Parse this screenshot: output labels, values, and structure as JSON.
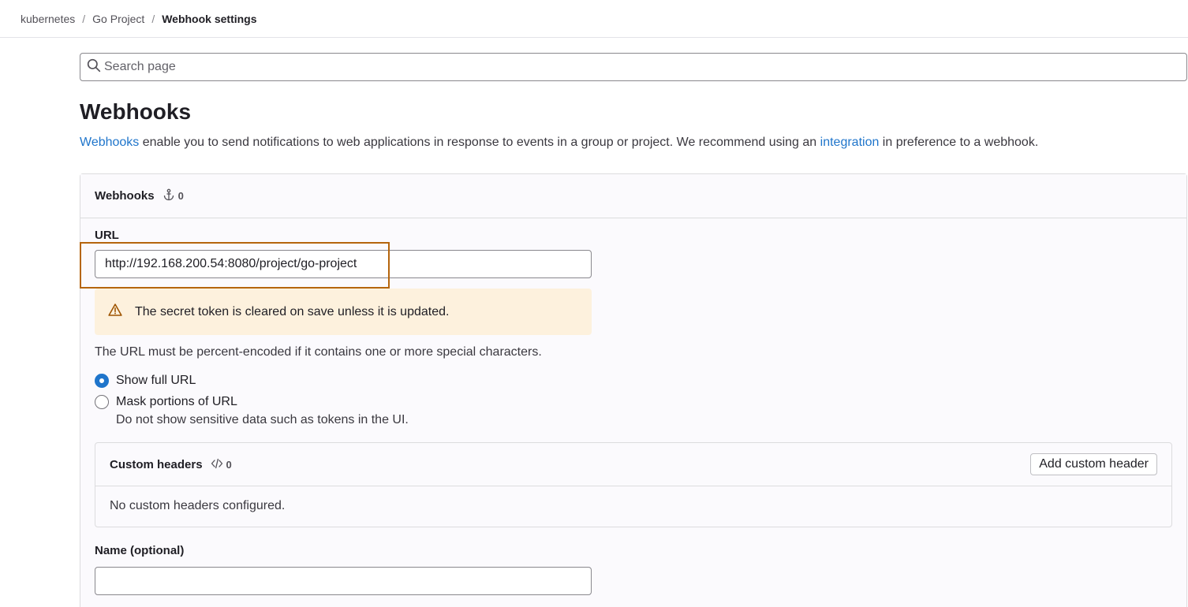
{
  "breadcrumb": {
    "items": [
      "kubernetes",
      "Go Project"
    ],
    "separator": "/",
    "current": "Webhook settings"
  },
  "search": {
    "placeholder": "Search page"
  },
  "page": {
    "title": "Webhooks",
    "description": {
      "link1": "Webhooks",
      "middle": " enable you to send notifications to web applications in response to events in a group or project. We recommend using an ",
      "link2": "integration",
      "end": " in preference to a webhook."
    }
  },
  "webhooks_card": {
    "title": "Webhooks",
    "count": "0",
    "url_label": "URL",
    "url_value": "http://192.168.200.54:8080/project/go-project",
    "alert_text": "The secret token is cleared on save unless it is updated.",
    "url_help": "The URL must be percent-encoded if it contains one or more special characters.",
    "radio_show_full": "Show full URL",
    "radio_mask": "Mask portions of URL",
    "radio_mask_help": "Do not show sensitive data such as tokens in the UI.",
    "name_label": "Name (optional)",
    "name_value": ""
  },
  "custom_headers": {
    "title": "Custom headers",
    "count": "0",
    "add_button": "Add custom header",
    "empty_text": "No custom headers configured."
  },
  "colors": {
    "link": "#1f75cb",
    "highlight": "#b5650d",
    "alert_bg": "#fdf1dd"
  }
}
